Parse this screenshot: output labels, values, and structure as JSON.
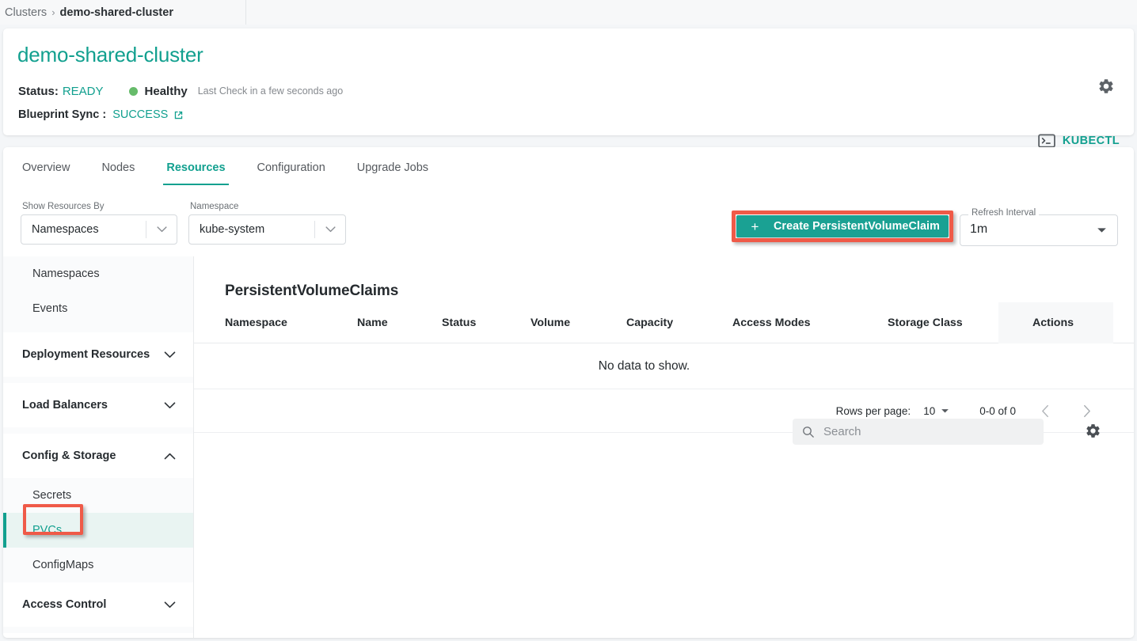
{
  "breadcrumb": {
    "root": "Clusters",
    "separator": "›",
    "current": "demo-shared-cluster"
  },
  "header": {
    "title": "demo-shared-cluster",
    "status_label": "Status:",
    "status_value": "READY",
    "health_text": "Healthy",
    "health_dot_color": "#66bb6a",
    "last_check": "Last Check in a few seconds ago",
    "sync_label": "Blueprint Sync :",
    "sync_value": "SUCCESS",
    "gear_icon": "gear-icon",
    "external_link_icon": "external-link-icon",
    "kubectl_label": "KUBECTL",
    "kubectl_icon": "terminal-icon"
  },
  "tabs": [
    {
      "label": "Overview",
      "active": false
    },
    {
      "label": "Nodes",
      "active": false
    },
    {
      "label": "Resources",
      "active": true
    },
    {
      "label": "Configuration",
      "active": false
    },
    {
      "label": "Upgrade Jobs",
      "active": false
    }
  ],
  "filters": {
    "show_by": {
      "label": "Show Resources By",
      "value": "Namespaces"
    },
    "namespace": {
      "label": "Namespace",
      "value": "kube-system"
    }
  },
  "create_button": {
    "plus": "+",
    "label": "Create PersistentVolumeClaim",
    "highlight_color": "#ef5a48"
  },
  "refresh": {
    "label": "Refresh Interval",
    "value": "1m"
  },
  "sidebar": {
    "top_items": [
      {
        "label": "Namespaces",
        "active": false
      },
      {
        "label": "Events",
        "active": false
      }
    ],
    "sections": [
      {
        "label": "Deployment Resources",
        "expanded": false,
        "chevron": "chevron-down-icon",
        "items": []
      },
      {
        "label": "Load Balancers",
        "expanded": false,
        "chevron": "chevron-down-icon",
        "items": []
      },
      {
        "label": "Config & Storage",
        "expanded": true,
        "chevron": "chevron-up-icon",
        "items": [
          {
            "label": "Secrets",
            "active": false
          },
          {
            "label": "PVCs",
            "active": true
          },
          {
            "label": "ConfigMaps",
            "active": false
          }
        ]
      },
      {
        "label": "Access Control",
        "expanded": false,
        "chevron": "chevron-down-icon",
        "items": []
      }
    ]
  },
  "table": {
    "title": "PersistentVolumeClaims",
    "search_placeholder": "Search",
    "search_value": "",
    "settings_icon": "gear-icon",
    "columns": [
      "Namespace",
      "Name",
      "Status",
      "Volume",
      "Capacity",
      "Access Modes",
      "Storage Class",
      "Actions"
    ],
    "rows": [],
    "empty_message": "No data to show."
  },
  "pagination": {
    "rows_per_page_label": "Rows per page:",
    "rows_per_page_value": "10",
    "range": "0-0 of 0",
    "prev_icon": "chevron-left-icon",
    "next_icon": "chevron-right-icon"
  },
  "colors": {
    "accent": "#12a08f",
    "button": "#1aa193",
    "highlight": "#ef5a48",
    "healthy": "#66bb6a"
  }
}
